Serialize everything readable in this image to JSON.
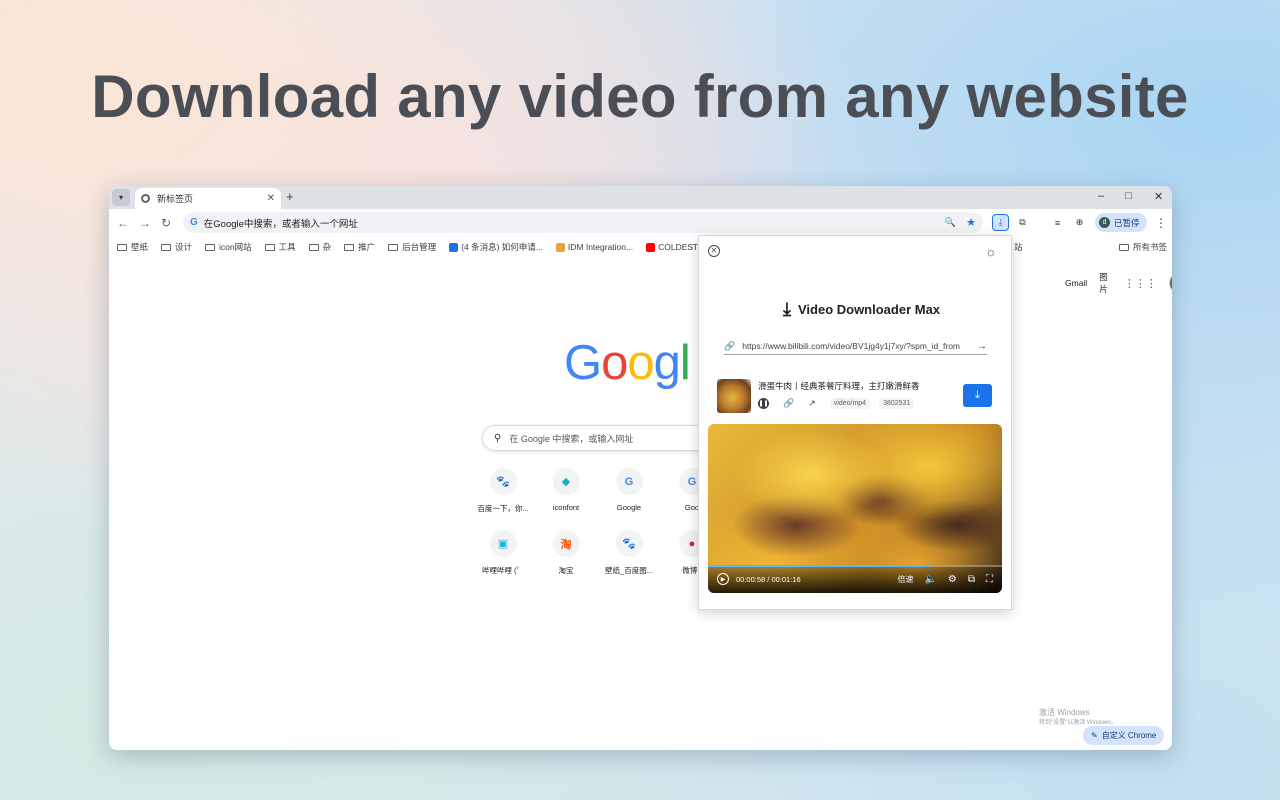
{
  "headline": "Download any video from any website",
  "tab": {
    "title": "新标签页",
    "close": "✕",
    "new": "+"
  },
  "window": {
    "minimize": "–",
    "maximize": "□",
    "close": "✕"
  },
  "toolbar": {
    "back": "←",
    "forward": "→",
    "reload": "↻",
    "omnibox_text": "在Google中搜索，或者输入一个网址",
    "paused_label": "已暂停",
    "avatar_letter": "d"
  },
  "bookmarks": [
    {
      "label": "壁纸",
      "kind": "folder"
    },
    {
      "label": "设计",
      "kind": "folder"
    },
    {
      "label": "icon网站",
      "kind": "folder"
    },
    {
      "label": "工具",
      "kind": "folder"
    },
    {
      "label": "杂",
      "kind": "folder"
    },
    {
      "label": "推广",
      "kind": "folder"
    },
    {
      "label": "后台管理",
      "kind": "folder"
    },
    {
      "label": "(4 条消息) 如何申请...",
      "kind": "link",
      "color": "#1a73e8"
    },
    {
      "label": "IDM Integration...",
      "kind": "link",
      "color": "#e8a33d"
    },
    {
      "label": "COLDEST Crossov...",
      "kind": "link",
      "color": "#ff0000"
    }
  ],
  "bookmarks_right": {
    "partial": "站",
    "all": "所有书签"
  },
  "page": {
    "gmail": "Gmail",
    "images": "图片",
    "search_placeholder": "在 Google 中搜索，或输入网址",
    "shortcuts": [
      {
        "label": "百度一下，你...",
        "glyph": "🐾",
        "color": "#2932e1"
      },
      {
        "label": "iconfont",
        "glyph": "◆",
        "color": "#1bb0c7"
      },
      {
        "label": "Google",
        "glyph": "G",
        "color": "#4285f4"
      },
      {
        "label": "Goo",
        "glyph": "G",
        "color": "#4285f4"
      },
      {
        "label": "哔哩哔哩 (゜",
        "glyph": "▣",
        "color": "#23ade5"
      },
      {
        "label": "淘宝",
        "glyph": "淘",
        "color": "#ff5000"
      },
      {
        "label": "壁纸_百度图...",
        "glyph": "🐾",
        "color": "#2932e1"
      },
      {
        "label": "微博 -",
        "glyph": "●",
        "color": "#e6162d"
      }
    ],
    "watermark_line1": "激活 Windows",
    "watermark_line2": "转到\"设置\"以激活 Windows。",
    "customize": "自定义 Chrome"
  },
  "popup": {
    "title": "Video Downloader Max",
    "url": "https://www.bilibili.com/video/BV1jg4y1j7xy/?spm_id_from",
    "item": {
      "title": "滑蛋牛肉丨经典茶餐厅料理，主打嫩滑鲜香",
      "format": "video/mp4",
      "size": "3802531"
    },
    "player": {
      "time": "00:00:58 / 00:01:16",
      "speed": "倍速",
      "progress": 0.76
    }
  },
  "colors": {
    "accent": "#1a73e8",
    "headline": "#4b4f55"
  }
}
